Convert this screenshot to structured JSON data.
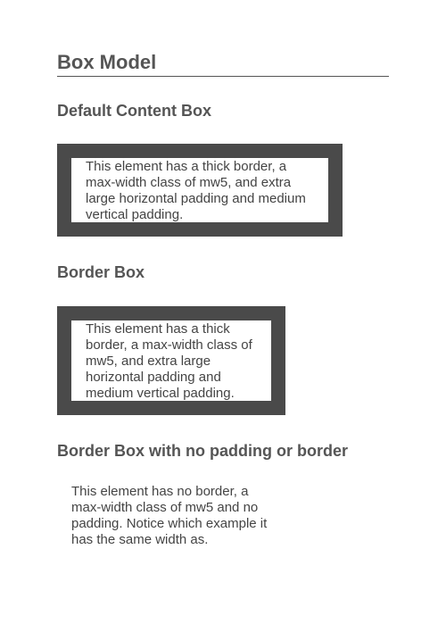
{
  "page": {
    "title": "Box Model"
  },
  "sections": [
    {
      "title": "Default Content Box",
      "text": "This element has a thick border, a max-width class of mw5, and extra large horizontal padding and medium vertical padding."
    },
    {
      "title": "Border Box",
      "text": "This element has a thick border, a max-width class of mw5, and extra large horizontal padding and medium vertical padding."
    },
    {
      "title": "Border Box with no padding or border",
      "text": "This element has no border, a max-width class of mw5 and no padding. Notice which example it has the same width as."
    }
  ],
  "colors": {
    "border": "#4a4a4a",
    "text": "#444444",
    "heading": "#555555"
  }
}
